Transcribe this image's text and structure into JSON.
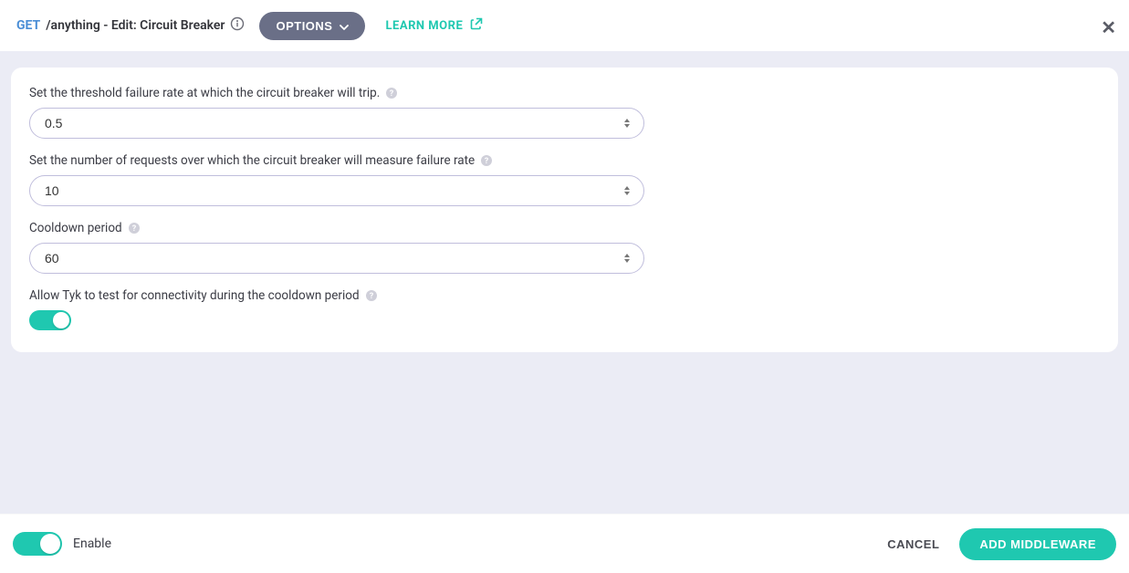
{
  "header": {
    "method": "GET",
    "title": "/anything - Edit: Circuit Breaker",
    "options_label": "OPTIONS",
    "learn_more_label": "LEARN MORE"
  },
  "form": {
    "threshold": {
      "label": "Set the threshold failure rate at which the circuit breaker will trip.",
      "value": "0.5"
    },
    "requests": {
      "label": "Set the number of requests over which the circuit breaker will measure failure rate",
      "value": "10"
    },
    "cooldown": {
      "label": "Cooldown period",
      "value": "60"
    },
    "connectivity_test": {
      "label": "Allow Tyk to test for connectivity during the cooldown period",
      "enabled": true
    }
  },
  "footer": {
    "enable_label": "Enable",
    "enabled": true,
    "cancel_label": "CANCEL",
    "add_label": "ADD MIDDLEWARE"
  }
}
